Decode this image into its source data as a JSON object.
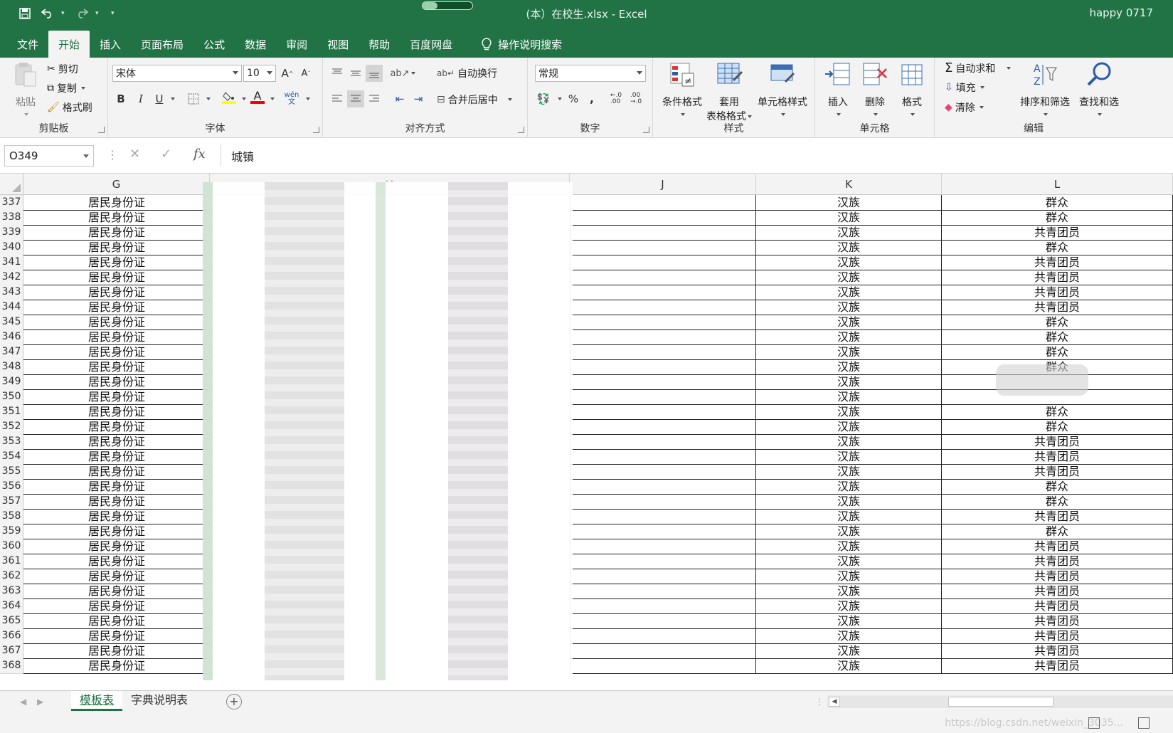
{
  "window": {
    "title": "(本）在校生.xlsx  -  Excel",
    "user": "happy 0717",
    "progress": 0.3
  },
  "qat": {
    "save_icon": "save-icon",
    "undo_icon": "undo-icon",
    "redo_icon": "redo-icon"
  },
  "tabs": [
    "文件",
    "开始",
    "插入",
    "页面布局",
    "公式",
    "数据",
    "审阅",
    "视图",
    "帮助",
    "百度网盘"
  ],
  "active_tab": "开始",
  "search_label": "操作说明搜索",
  "ribbon": {
    "clipboard": {
      "paste": "粘贴",
      "cut": "剪切",
      "copy": "复制",
      "format_painter": "格式刷",
      "label": "剪贴板"
    },
    "font": {
      "name": "宋体",
      "size": "10",
      "bold": "B",
      "italic": "I",
      "underline": "U",
      "label": "字体",
      "phonetic": "wén\n文"
    },
    "alignment": {
      "wrap": "自动换行",
      "merge": "合并后居中",
      "label": "对齐方式"
    },
    "number": {
      "format": "常规",
      "label": "数字"
    },
    "styles": {
      "cond": "条件格式",
      "table1": "套用",
      "table2": "表格格式",
      "cell": "单元格样式",
      "label": "样式"
    },
    "cells": {
      "insert": "插入",
      "delete": "删除",
      "format": "格式",
      "label": "单元格"
    },
    "editing": {
      "autosum": "自动求和",
      "fill": "填充",
      "clear": "清除",
      "sort": "排序和筛选",
      "find": "查找和选",
      "label": "编辑"
    }
  },
  "formula_bar": {
    "name_box": "O349",
    "value": "城镇"
  },
  "columns": {
    "g": "G",
    "h": "H",
    "j": "J",
    "k": "K",
    "l": "L"
  },
  "rows": [
    {
      "n": "337",
      "g": "居民身份证",
      "k": "汉族",
      "l": "群众"
    },
    {
      "n": "338",
      "g": "居民身份证",
      "k": "汉族",
      "l": "群众"
    },
    {
      "n": "339",
      "g": "居民身份证",
      "k": "汉族",
      "l": "共青团员"
    },
    {
      "n": "340",
      "g": "居民身份证",
      "k": "汉族",
      "l": "群众"
    },
    {
      "n": "341",
      "g": "居民身份证",
      "k": "汉族",
      "l": "共青团员"
    },
    {
      "n": "342",
      "g": "居民身份证",
      "k": "汉族",
      "l": "共青团员"
    },
    {
      "n": "343",
      "g": "居民身份证",
      "k": "汉族",
      "l": "共青团员"
    },
    {
      "n": "344",
      "g": "居民身份证",
      "k": "汉族",
      "l": "共青团员"
    },
    {
      "n": "345",
      "g": "居民身份证",
      "k": "汉族",
      "l": "群众"
    },
    {
      "n": "346",
      "g": "居民身份证",
      "k": "汉族",
      "l": "群众"
    },
    {
      "n": "347",
      "g": "居民身份证",
      "k": "汉族",
      "l": "群众"
    },
    {
      "n": "348",
      "g": "居民身份证",
      "k": "汉族",
      "l": "群众"
    },
    {
      "n": "349",
      "g": "居民身份证",
      "k": "汉族",
      "l": ""
    },
    {
      "n": "350",
      "g": "居民身份证",
      "k": "汉族",
      "l": ""
    },
    {
      "n": "351",
      "g": "居民身份证",
      "k": "汉族",
      "l": "群众"
    },
    {
      "n": "352",
      "g": "居民身份证",
      "k": "汉族",
      "l": "群众"
    },
    {
      "n": "353",
      "g": "居民身份证",
      "k": "汉族",
      "l": "共青团员"
    },
    {
      "n": "354",
      "g": "居民身份证",
      "k": "汉族",
      "l": "共青团员"
    },
    {
      "n": "355",
      "g": "居民身份证",
      "k": "汉族",
      "l": "共青团员"
    },
    {
      "n": "356",
      "g": "居民身份证",
      "k": "汉族",
      "l": "群众"
    },
    {
      "n": "357",
      "g": "居民身份证",
      "k": "汉族",
      "l": "群众"
    },
    {
      "n": "358",
      "g": "居民身份证",
      "k": "汉族",
      "l": "共青团员"
    },
    {
      "n": "359",
      "g": "居民身份证",
      "k": "汉族",
      "l": "群众"
    },
    {
      "n": "360",
      "g": "居民身份证",
      "k": "汉族",
      "l": "共青团员"
    },
    {
      "n": "361",
      "g": "居民身份证",
      "k": "汉族",
      "l": "共青团员"
    },
    {
      "n": "362",
      "g": "居民身份证",
      "k": "汉族",
      "l": "共青团员"
    },
    {
      "n": "363",
      "g": "居民身份证",
      "k": "汉族",
      "l": "共青团员"
    },
    {
      "n": "364",
      "g": "居民身份证",
      "k": "汉族",
      "l": "共青团员"
    },
    {
      "n": "365",
      "g": "居民身份证",
      "k": "汉族",
      "l": "共青团员"
    },
    {
      "n": "366",
      "g": "居民身份证",
      "k": "汉族",
      "l": "共青团员"
    },
    {
      "n": "367",
      "g": "居民身份证",
      "k": "汉族",
      "l": "共青团员"
    },
    {
      "n": "368",
      "g": "居民身份证",
      "k": "汉族",
      "l": "共青团员"
    }
  ],
  "sheets": [
    "模板表",
    "字典说明表"
  ],
  "active_sheet": "模板表",
  "watermark": "https://blog.csdn.net/weixin_3035...",
  "colors": {
    "accent": "#217346"
  }
}
